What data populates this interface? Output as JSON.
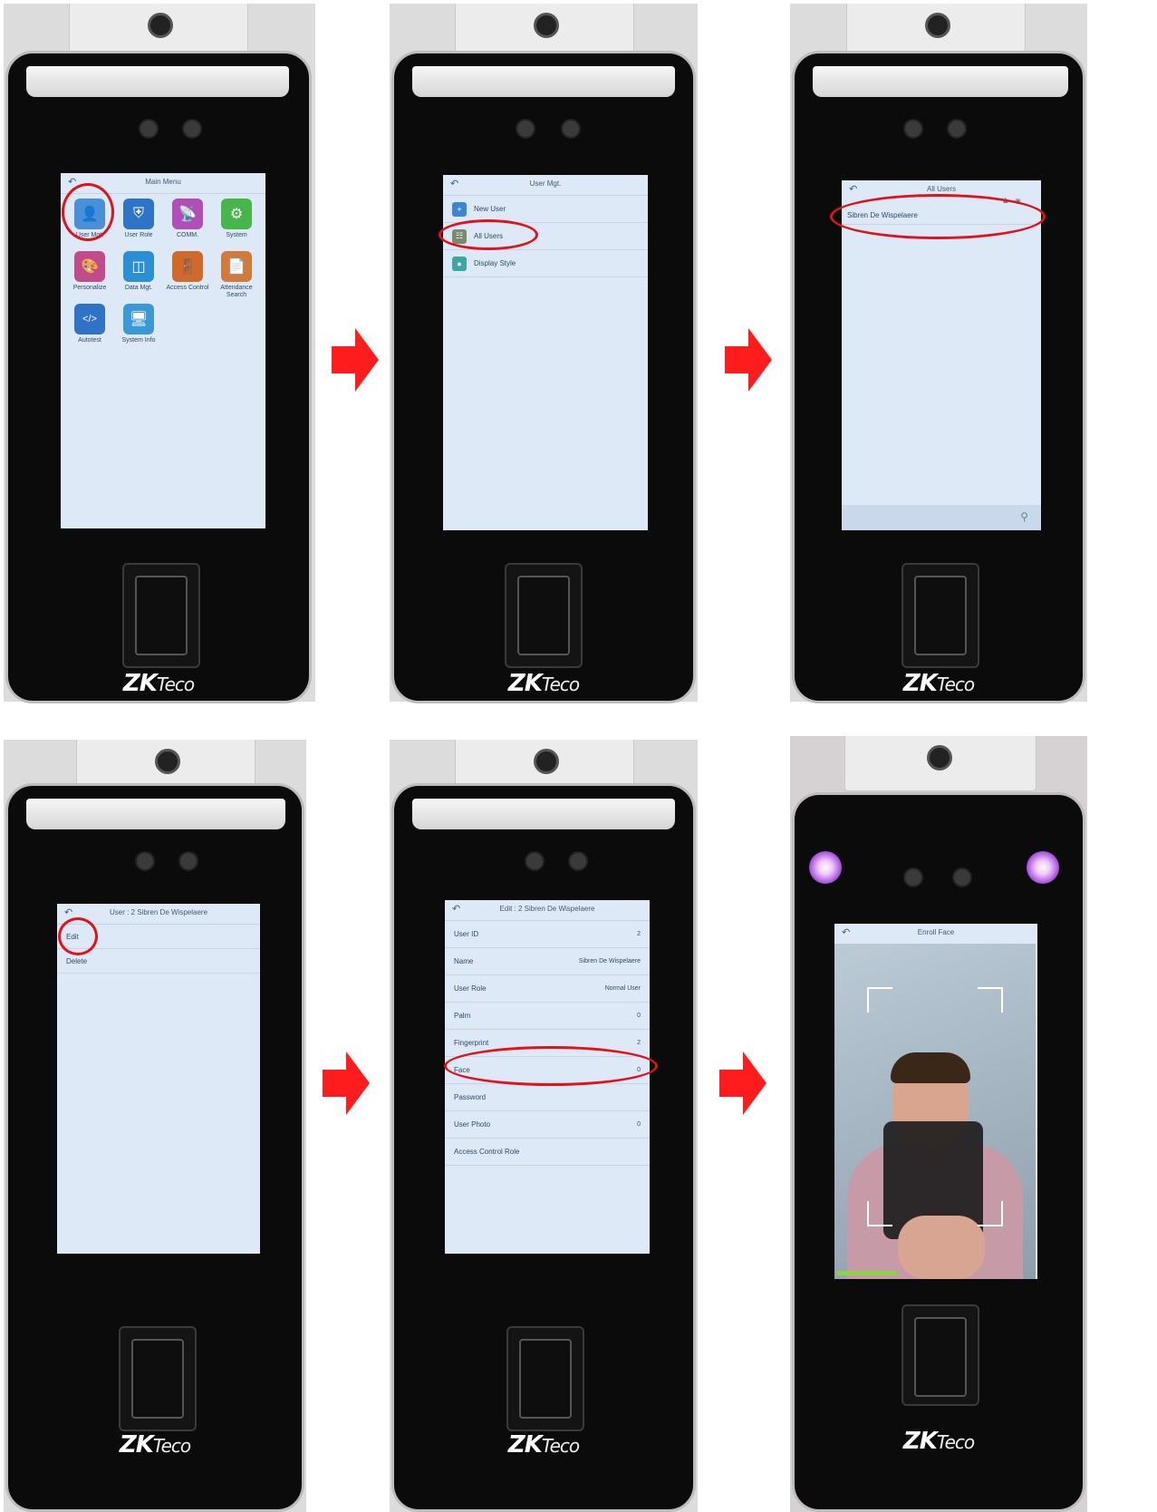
{
  "brand": {
    "zk": "ZK",
    "eco": "Teco"
  },
  "colors": {
    "highlight": "#e0121a",
    "arrow": "#ff1c1c",
    "screen_bg": "#dde9f7"
  },
  "panel1": {
    "title": "Main Menu",
    "items": [
      {
        "label": "User Mgt.",
        "icon": "user-icon",
        "color": "#4a90d9"
      },
      {
        "label": "User Role",
        "icon": "shield-icon",
        "color": "#2f73c6"
      },
      {
        "label": "COMM.",
        "icon": "satellite-icon",
        "color": "#b04fb8"
      },
      {
        "label": "System",
        "icon": "gear-icon",
        "color": "#46b54a"
      },
      {
        "label": "Personalize",
        "icon": "palette-icon",
        "color": "#c24b8e"
      },
      {
        "label": "Data Mgt.",
        "icon": "database-icon",
        "color": "#2b8fd6"
      },
      {
        "label": "Access Control",
        "icon": "door-icon",
        "color": "#d06a2a"
      },
      {
        "label": "Attendance Search",
        "icon": "document-search-icon",
        "color": "#d27a3a"
      },
      {
        "label": "Autotest",
        "icon": "code-icon",
        "color": "#2f73c6"
      },
      {
        "label": "System Info",
        "icon": "monitor-icon",
        "color": "#3b9ad6"
      }
    ]
  },
  "panel2": {
    "title": "User Mgt.",
    "items": [
      {
        "label": "New User",
        "icon": "add-user-icon",
        "color": "#3b86d1"
      },
      {
        "label": "All Users",
        "icon": "users-icon",
        "color": "#7a8a70"
      },
      {
        "label": "Display Style",
        "icon": "display-style-icon",
        "color": "#3aa7a0"
      }
    ]
  },
  "panel3": {
    "title": "All Users",
    "user": "Sibren De Wispelaere"
  },
  "panel4": {
    "title": "User : 2 Sibren De Wispelaere",
    "items": [
      "Edit",
      "Delete"
    ]
  },
  "panel5": {
    "title": "Edit : 2 Sibren De Wispelaere",
    "rows": [
      {
        "label": "User ID",
        "value": "2"
      },
      {
        "label": "Name",
        "value": "Sibren De Wispelaere"
      },
      {
        "label": "User Role",
        "value": "Normal User"
      },
      {
        "label": "Palm",
        "value": "0"
      },
      {
        "label": "Fingerprint",
        "value": "2"
      },
      {
        "label": "Face",
        "value": "0"
      },
      {
        "label": "Password",
        "value": ""
      },
      {
        "label": "User Photo",
        "value": "0"
      },
      {
        "label": "Access Control Role",
        "value": ""
      }
    ]
  },
  "panel6": {
    "title": "Enroll Face",
    "progress": 0.3
  }
}
